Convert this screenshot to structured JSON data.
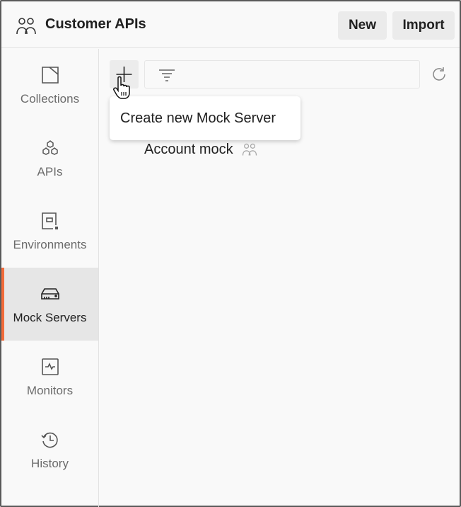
{
  "header": {
    "title": "Customer APIs",
    "new_label": "New",
    "import_label": "Import"
  },
  "sidebar": {
    "items": [
      {
        "label": "Collections",
        "icon": "collections-icon"
      },
      {
        "label": "APIs",
        "icon": "apis-icon"
      },
      {
        "label": "Environments",
        "icon": "environments-icon"
      },
      {
        "label": "Mock Servers",
        "icon": "mock-servers-icon",
        "active": true
      },
      {
        "label": "Monitors",
        "icon": "monitors-icon"
      },
      {
        "label": "History",
        "icon": "history-icon"
      }
    ]
  },
  "main": {
    "tooltip": "Create new Mock Server",
    "list": [
      {
        "name": "Account mock",
        "icon": "team-icon"
      }
    ]
  },
  "colors": {
    "accent": "#f26b3a",
    "active_bg": "#e6e6e6"
  }
}
